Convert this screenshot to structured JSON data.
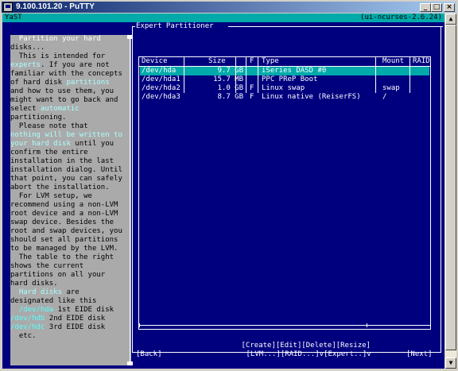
{
  "window": {
    "title": "9.100.101.20 - PuTTY",
    "minimize": "_",
    "maximize": "□",
    "close": "×"
  },
  "topbar": {
    "left": "YaST",
    "right": "(ui-ncurses-2.6.24)"
  },
  "help_lines": [
    [
      {
        "t": "  Partition your hard",
        "c": "w"
      }
    ],
    [
      {
        "t": "disks...",
        "c": ""
      }
    ],
    [
      {
        "t": "  This is intended for",
        "c": ""
      }
    ],
    [
      {
        "t": "experts",
        "c": "c"
      },
      {
        "t": ". If you are not",
        "c": ""
      }
    ],
    [
      {
        "t": "familiar with the concepts",
        "c": ""
      }
    ],
    [
      {
        "t": "of hard disk ",
        "c": ""
      },
      {
        "t": "partitions",
        "c": "c"
      }
    ],
    [
      {
        "t": "and how to use them, you",
        "c": ""
      }
    ],
    [
      {
        "t": "might want to go back and",
        "c": ""
      }
    ],
    [
      {
        "t": "select ",
        "c": ""
      },
      {
        "t": "automatic",
        "c": "c"
      }
    ],
    [
      {
        "t": "partitioning.",
        "c": ""
      }
    ],
    [
      {
        "t": "  Please note that",
        "c": ""
      }
    ],
    [
      {
        "t": "nothing will be written to",
        "c": "c"
      }
    ],
    [
      {
        "t": "your hard disk",
        "c": "c"
      },
      {
        "t": " until you",
        "c": ""
      }
    ],
    [
      {
        "t": "confirm the entire",
        "c": ""
      }
    ],
    [
      {
        "t": "installation in the last",
        "c": ""
      }
    ],
    [
      {
        "t": "installation dialog. Until",
        "c": ""
      }
    ],
    [
      {
        "t": "that point, you can safely",
        "c": ""
      }
    ],
    [
      {
        "t": "abort the installation.",
        "c": ""
      }
    ],
    [
      {
        "t": "  For LVM setup, we",
        "c": ""
      }
    ],
    [
      {
        "t": "recommend using a non-LVM",
        "c": ""
      }
    ],
    [
      {
        "t": "root device and a non-LVM",
        "c": ""
      }
    ],
    [
      {
        "t": "swap device. Besides the",
        "c": ""
      }
    ],
    [
      {
        "t": "root and swap devices, you",
        "c": ""
      }
    ],
    [
      {
        "t": "should set all partitions",
        "c": ""
      }
    ],
    [
      {
        "t": "to be managed by the LVM.",
        "c": ""
      }
    ],
    [
      {
        "t": "  The table to the right",
        "c": ""
      }
    ],
    [
      {
        "t": "shows the current",
        "c": ""
      }
    ],
    [
      {
        "t": "partitions on all your",
        "c": ""
      }
    ],
    [
      {
        "t": "hard disks.",
        "c": ""
      }
    ],
    [
      {
        "t": "  Hard disks",
        "c": "c"
      },
      {
        "t": " are",
        "c": ""
      }
    ],
    [
      {
        "t": "designated like this",
        "c": ""
      }
    ],
    [
      {
        "t": "  /dev/hda",
        "c": "hk"
      },
      {
        "t": " 1st EIDE disk",
        "c": ""
      }
    ],
    [
      {
        "t": "/dev/hdb",
        "c": "hk"
      },
      {
        "t": " 2nd EIDE disk",
        "c": ""
      }
    ],
    [
      {
        "t": "/dev/hdc",
        "c": "hk"
      },
      {
        "t": " 3rd EIDE disk",
        "c": ""
      }
    ],
    [
      {
        "t": "  etc.",
        "c": ""
      }
    ]
  ],
  "main": {
    "title": "Expert Partitioner",
    "table": {
      "columns": [
        "Device",
        "Size",
        "F",
        "Type",
        "Mount",
        "RAID"
      ],
      "rows": [
        {
          "device": "/dev/hda",
          "size": "9.7 GB",
          "f": "",
          "type": "iSeries DASD #0",
          "mount": "",
          "raid": ""
        },
        {
          "device": "/dev/hda1",
          "size": "15.7 MB",
          "f": "",
          "type": "PPC PReP Boot",
          "mount": "",
          "raid": ""
        },
        {
          "device": "/dev/hda2",
          "size": "1.0 GB",
          "f": "F",
          "type": "Linux swap",
          "mount": "swap",
          "raid": ""
        },
        {
          "device": "/dev/hda3",
          "size": "8.7 GB",
          "f": "F",
          "type": "Linux native (ReiserFS)",
          "mount": "/",
          "raid": ""
        }
      ]
    },
    "buttons_row1": [
      "[Create]",
      "[Edit]",
      "[Delete]",
      "[Resize]"
    ],
    "buttons_row2": [
      "[LVM...]",
      "[RAID...]",
      "v[Expert..]",
      "v"
    ],
    "back": "[Back]",
    "next": "[Next]"
  }
}
